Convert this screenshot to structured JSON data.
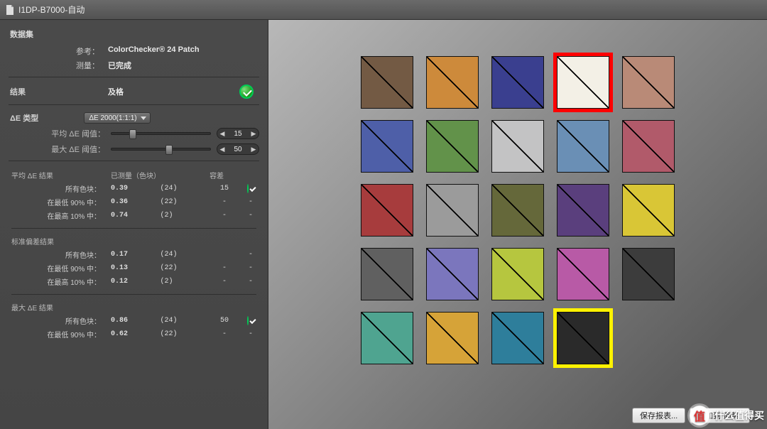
{
  "window": {
    "title": "I1DP-B7000-自动"
  },
  "dataset": {
    "heading": "数据集",
    "reference_label": "参考：",
    "reference_value": "ColorChecker® 24 Patch",
    "measure_label": "测量：",
    "measure_value": "已完成"
  },
  "result": {
    "label": "结果",
    "value": "及格"
  },
  "de_type": {
    "label": "ΔE 类型",
    "selected": "ΔE 2000(1:1:1)"
  },
  "thresholds": {
    "avg_label": "平均 ΔE 阈值：",
    "avg_value": "15",
    "max_label": "最大 ΔE 阈值：",
    "max_value": "50"
  },
  "table": {
    "col_measured": "已测量（色块）",
    "col_tolerance": "容差",
    "sections": {
      "avg": {
        "heading": "平均 ΔE 结果",
        "rows": [
          {
            "label": "所有色块：",
            "val": "0.39",
            "count": "(24)",
            "tol": "15",
            "pass": true
          },
          {
            "label": "在最低 90% 中：",
            "val": "0.36",
            "count": "(22)",
            "tol": "-",
            "pass": null
          },
          {
            "label": "在最高 10% 中：",
            "val": "0.74",
            "count": "(2)",
            "tol": "-",
            "pass": null
          }
        ]
      },
      "std": {
        "heading": "标准偏差结果",
        "rows": [
          {
            "label": "所有色块：",
            "val": "0.17",
            "count": "(24)",
            "tol": "",
            "pass": null
          },
          {
            "label": "在最低 90% 中：",
            "val": "0.13",
            "count": "(22)",
            "tol": "-",
            "pass": null
          },
          {
            "label": "在最高 10% 中：",
            "val": "0.12",
            "count": "(2)",
            "tol": "-",
            "pass": null
          }
        ]
      },
      "max": {
        "heading": "最大 ΔE 结果",
        "rows": [
          {
            "label": "所有色块：",
            "val": "0.86",
            "count": "(24)",
            "tol": "50",
            "pass": true
          },
          {
            "label": "在最低 90% 中：",
            "val": "0.62",
            "count": "(22)",
            "tol": "-",
            "pass": null
          }
        ]
      }
    }
  },
  "buttons": {
    "save_report": "保存报表...",
    "add_to_trend": "添加到\"趋势\""
  },
  "watermark": {
    "text": "什么值得买",
    "logo": "值"
  },
  "swatches": {
    "colors": [
      "#735a44",
      "#cd8a3b",
      "#3a3f8f",
      "#f3f0e6",
      "#b98a77",
      "#4e5fa8",
      "#62924a",
      "#c3c3c4",
      "#6a8fb5",
      "#b15a6a",
      "#a73c3d",
      "#9b9b9b",
      "#65683a",
      "#5a3f7d",
      "#d9c636",
      "#606060",
      "#7b76bd",
      "#b6c63f",
      "#b85aa6",
      "#3c3c3c",
      "#4fa490",
      "#d6a338",
      "#2e7e9b",
      "#2a2a2a"
    ],
    "highlight_red_index": 3,
    "highlight_yellow_index": 23,
    "last_row_visible_until": 24
  }
}
